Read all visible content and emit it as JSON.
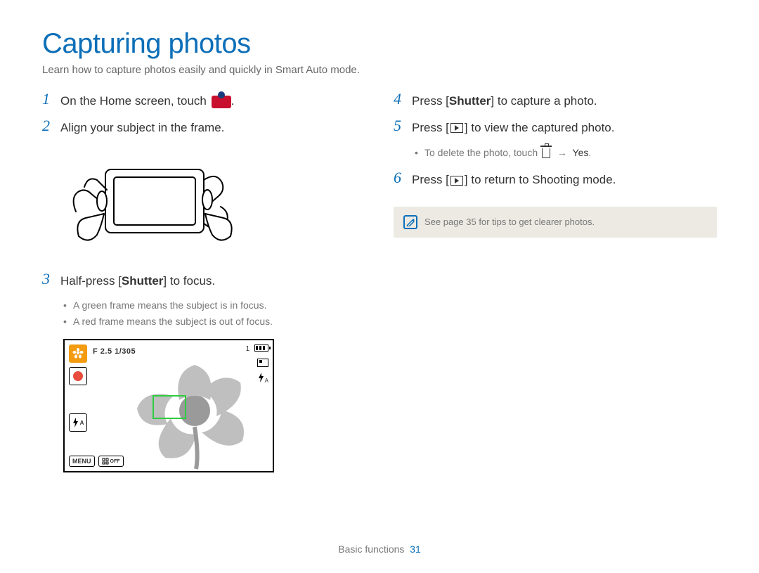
{
  "title": "Capturing photos",
  "subtitle": "Learn how to capture photos easily and quickly in Smart Auto mode.",
  "left": {
    "step1_num": "1",
    "step1_text": "On the Home screen, touch",
    "step2_num": "2",
    "step2_text": "Align your subject in the frame.",
    "step3_num": "3",
    "step3_pre": "Half-press [",
    "step3_bold": "Shutter",
    "step3_post": "] to focus.",
    "bullet_a": "A green frame means the subject is in focus.",
    "bullet_b": "A red frame means the subject is out of focus.",
    "screen": {
      "exif": "F 2.5 1/305",
      "count": "1",
      "flash_a": "A",
      "menu": "MENU",
      "off": "OFF"
    }
  },
  "right": {
    "step4_num": "4",
    "step4_pre": "Press [",
    "step4_bold": "Shutter",
    "step4_post": "] to capture a photo.",
    "step5_num": "5",
    "step5_pre": "Press [",
    "step5_post": "] to view the captured photo.",
    "delete_pre": "To delete the photo, touch ",
    "delete_arrow": "→",
    "delete_yes": "Yes",
    "delete_post": ".",
    "step6_num": "6",
    "step6_pre": "Press [",
    "step6_post": "] to return to Shooting mode.",
    "note": "See page 35 for tips to get clearer photos."
  },
  "footer": {
    "section": "Basic functions",
    "page": "31"
  }
}
